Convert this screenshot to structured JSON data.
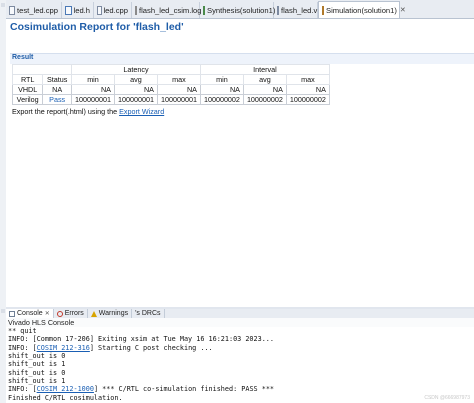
{
  "tabs": [
    {
      "label": "test_led.cpp",
      "icon": "cpp-file-icon",
      "active": false
    },
    {
      "label": "led.h",
      "icon": "header-file-icon",
      "active": false
    },
    {
      "label": "led.cpp",
      "icon": "cpp-file-icon",
      "active": false
    },
    {
      "label": "flash_led_csim.log",
      "icon": "log-file-icon",
      "active": false
    },
    {
      "label": "Synthesis(solution1)",
      "icon": "synthesis-report-icon",
      "active": false
    },
    {
      "label": "flash_led.v",
      "icon": "verilog-file-icon",
      "active": false
    },
    {
      "label": "Simulation(solution1)",
      "icon": "simulation-report-icon",
      "active": true
    }
  ],
  "report": {
    "title": "Cosimulation Report for 'flash_led'",
    "section": "Result",
    "headers": {
      "latency": "Latency",
      "interval": "Interval"
    },
    "columns": [
      "RTL",
      "Status",
      "min",
      "avg",
      "max",
      "min",
      "avg",
      "max"
    ],
    "rows": [
      [
        "VHDL",
        "NA",
        "NA",
        "NA",
        "NA",
        "NA",
        "NA",
        "NA"
      ],
      [
        "Verilog",
        "Pass",
        "100000001",
        "100000001",
        "100000001",
        "100000002",
        "100000002",
        "100000002"
      ]
    ],
    "export_prefix": "Export the report(.html) using the ",
    "export_link": "Export Wizard"
  },
  "console_tabs": [
    {
      "label": "Console",
      "icon": "console-icon",
      "active": true
    },
    {
      "label": "Errors",
      "icon": "errors-icon",
      "active": false
    },
    {
      "label": "Warnings",
      "icon": "warnings-icon",
      "active": false
    },
    {
      "label": "'s DRCs",
      "icon": "drcs-icon",
      "active": false
    }
  ],
  "console_title": "Vivado HLS Console",
  "console_lines": [
    {
      "pre": "** quit",
      "link": "",
      "post": ""
    },
    {
      "pre": "INFO: [Common 17-206] Exiting xsim at Tue May 16 16:21:03 2023...",
      "link": "",
      "post": ""
    },
    {
      "pre": "INFO: [",
      "link": "COSIM 212-316",
      "post": "] Starting C post checking ..."
    },
    {
      "pre": "shift_out is 0",
      "link": "",
      "post": ""
    },
    {
      "pre": "shift_out is 1",
      "link": "",
      "post": ""
    },
    {
      "pre": "shift_out is 0",
      "link": "",
      "post": ""
    },
    {
      "pre": "shift_out is 1",
      "link": "",
      "post": ""
    },
    {
      "pre": "INFO: [",
      "link": "COSIM 212-1000",
      "post": "] *** C/RTL co-simulation finished: PASS ***"
    },
    {
      "pre": "Finished C/RTL cosimulation.",
      "link": "",
      "post": ""
    }
  ],
  "watermark": "CSDN @666987973"
}
